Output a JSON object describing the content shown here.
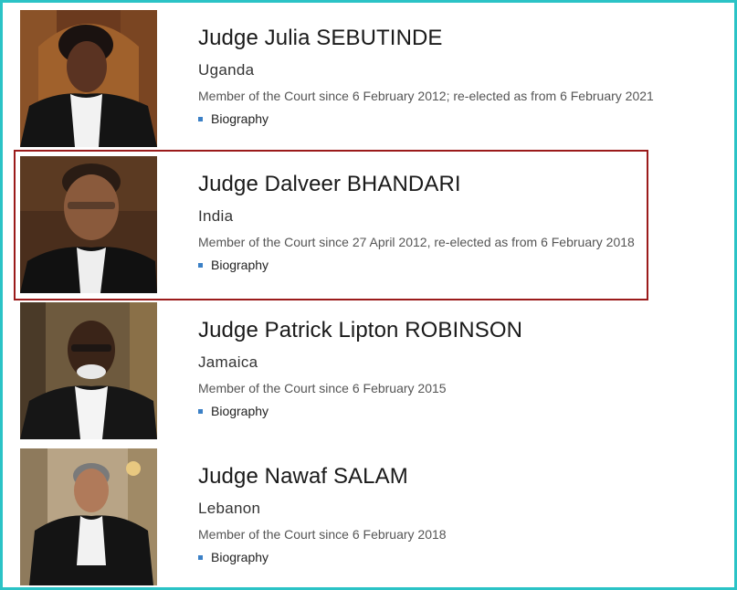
{
  "judges": [
    {
      "name": "Judge Julia SEBUTINDE",
      "country": "Uganda",
      "membership": "Member of the Court since 6 February 2012; re-elected as from 6 February 2021",
      "link": "Biography"
    },
    {
      "name": "Judge Dalveer BHANDARI",
      "country": "India",
      "membership": "Member of the Court since 27 April 2012, re-elected as from 6 February 2018",
      "link": "Biography"
    },
    {
      "name": "Judge Patrick Lipton ROBINSON",
      "country": "Jamaica",
      "membership": "Member of the Court since 6 February 2015",
      "link": "Biography"
    },
    {
      "name": "Judge Nawaf SALAM",
      "country": "Lebanon",
      "membership": "Member of the Court since 6 February 2018",
      "link": "Biography"
    }
  ],
  "colors": {
    "frame_border": "#2bc3c6",
    "highlight_border": "#9b1b1b",
    "bullet": "#3b80c6"
  },
  "icons": {
    "bullet": "square-bullet-icon"
  }
}
